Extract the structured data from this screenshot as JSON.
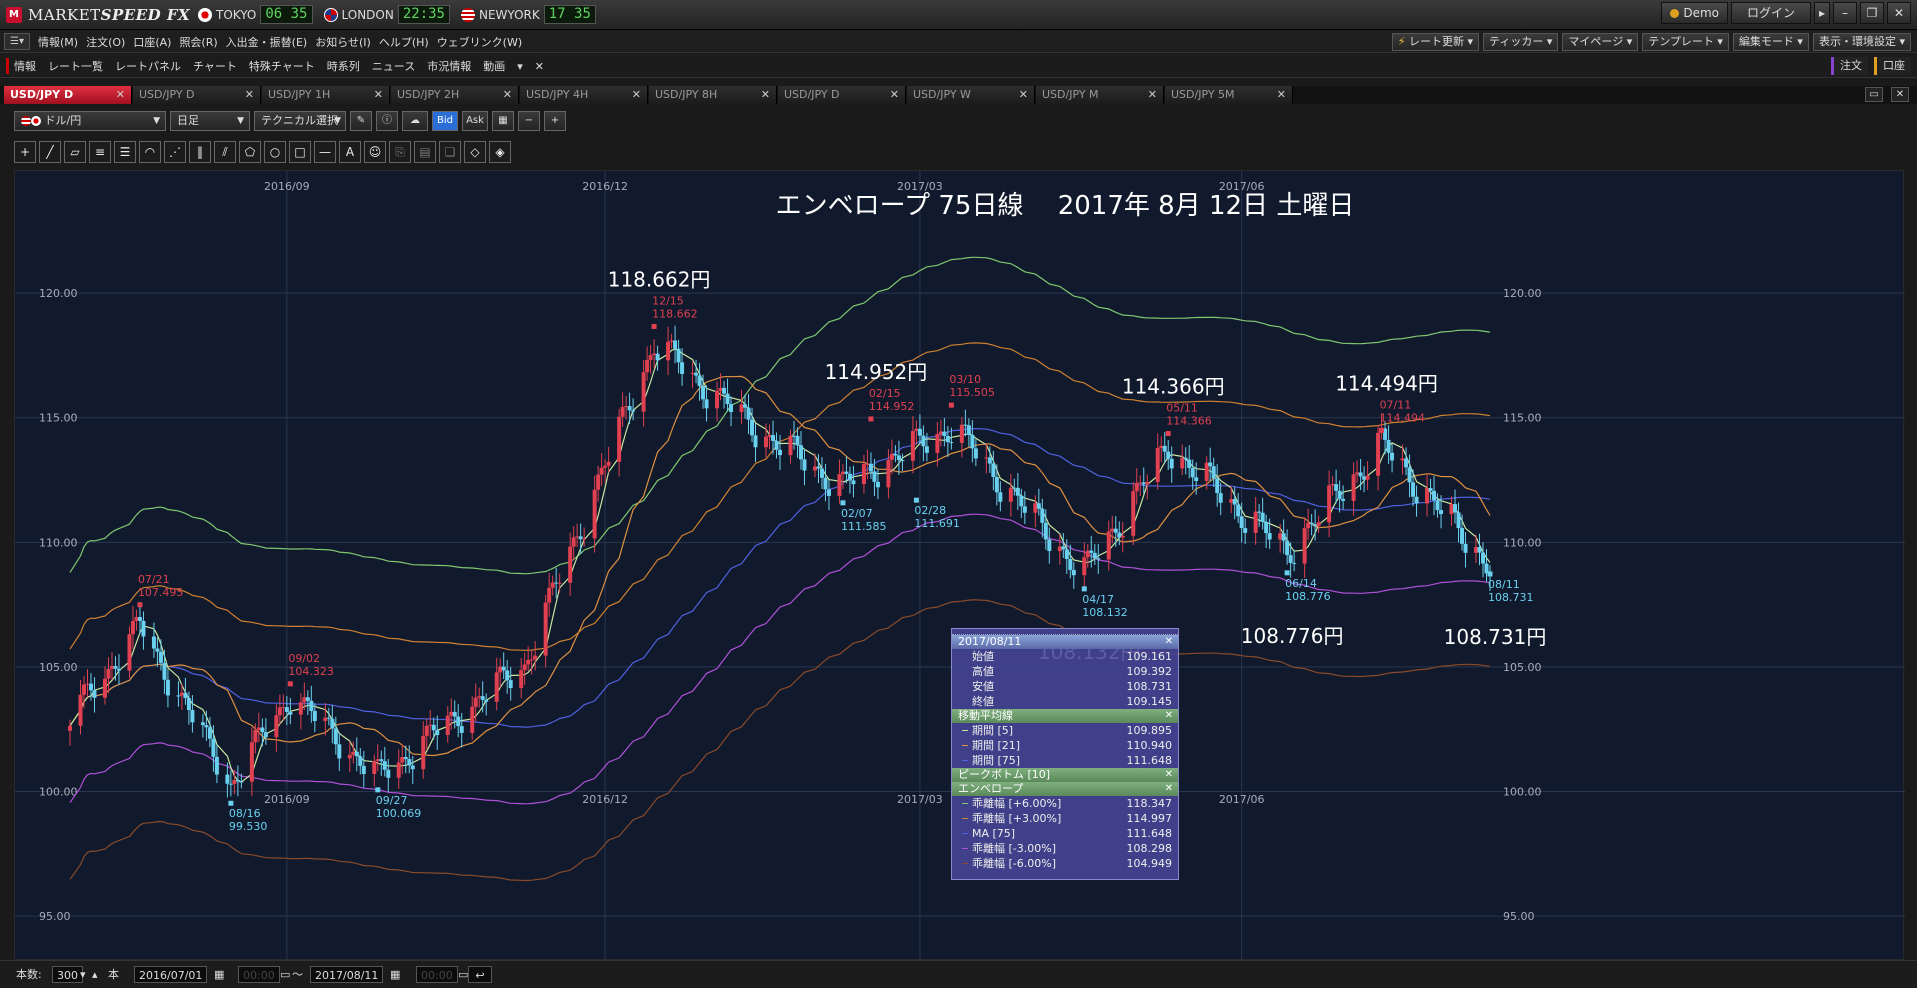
{
  "titlebar": {
    "brand_left": "MARKET",
    "brand_right": "SPEED FX",
    "clocks": [
      {
        "city": "TOKYO",
        "time": "06 35"
      },
      {
        "city": "LONDON",
        "time": "22:35"
      },
      {
        "city": "NEWYORK",
        "time": "17 35"
      }
    ],
    "demo_label": "Demo",
    "login_label": "ログイン"
  },
  "menubar": {
    "items": [
      "情報(M)",
      "注文(O)",
      "口座(A)",
      "照会(R)",
      "入出金・振替(E)",
      "お知らせ(I)",
      "ヘルプ(H)",
      "ウェブリンク(W)"
    ],
    "right_items": [
      "レート更新",
      "ティッカー",
      "マイページ",
      "テンプレート",
      "編集モード",
      "表示・環境設定"
    ]
  },
  "secbar": {
    "items": [
      "情報",
      "レート一覧",
      "レートパネル",
      "チャート",
      "特殊チャート",
      "時系列",
      "ニュース",
      "市況情報",
      "動画"
    ],
    "right_items": [
      "注文",
      "口座"
    ]
  },
  "tabs": [
    "USD/JPY D",
    "USD/JPY D",
    "USD/JPY 1H",
    "USD/JPY 2H",
    "USD/JPY 4H",
    "USD/JPY 8H",
    "USD/JPY D",
    "USD/JPY W",
    "USD/JPY M",
    "USD/JPY 5M"
  ],
  "toolbar": {
    "symbol": "ドル/円",
    "period": "日足",
    "technical": "テクニカル選択",
    "bid": "Bid",
    "ask": "Ask"
  },
  "chart_data": {
    "type": "candlestick",
    "title": "エンベロープ 75日線　 2017年 8月 12日 土曜日",
    "y_ticks": [
      "120.00",
      "115.00",
      "110.00",
      "105.00",
      "100.00",
      "95.00"
    ],
    "ylim": [
      93.2,
      124.9
    ],
    "x_ticks": [
      "2016/09",
      "2016/12",
      "2017/03",
      "2017/06"
    ],
    "peaks": [
      {
        "date": "07/21",
        "value": "107.495",
        "big": ""
      },
      {
        "date": "09/02",
        "value": "104.323",
        "big": ""
      },
      {
        "date": "12/15",
        "value": "118.662",
        "big": "118.662円"
      },
      {
        "date": "02/15",
        "value": "114.952",
        "big": "114.952円"
      },
      {
        "date": "03/10",
        "value": "115.505",
        "big": ""
      },
      {
        "date": "05/11",
        "value": "114.366",
        "big": "114.366円"
      },
      {
        "date": "07/11",
        "value": "114.494",
        "big": "114.494円"
      }
    ],
    "troughs": [
      {
        "date": "08/16",
        "value": "99.530",
        "big": ""
      },
      {
        "date": "09/27",
        "value": "100.069",
        "big": ""
      },
      {
        "date": "02/07",
        "value": "111.585",
        "big": ""
      },
      {
        "date": "02/28",
        "value": "111.691",
        "big": ""
      },
      {
        "date": "04/17",
        "value": "108.132",
        "big": "108.132円"
      },
      {
        "date": "06/14",
        "value": "108.776",
        "big": "108.776円"
      },
      {
        "date": "08/11",
        "value": "108.731",
        "big": "108.731円"
      }
    ],
    "key_closes": [
      {
        "date": "2016/07/01",
        "value": 102.8
      },
      {
        "date": "2016/07/21",
        "value": 106.5
      },
      {
        "date": "2016/08/16",
        "value": 100.2
      },
      {
        "date": "2016/09/02",
        "value": 103.8
      },
      {
        "date": "2016/09/27",
        "value": 100.5
      },
      {
        "date": "2016/11/08",
        "value": 105.0
      },
      {
        "date": "2016/12/15",
        "value": 117.9
      },
      {
        "date": "2017/01/13",
        "value": 114.5
      },
      {
        "date": "2017/02/07",
        "value": 112.2
      },
      {
        "date": "2017/03/10",
        "value": 114.6
      },
      {
        "date": "2017/04/17",
        "value": 108.7
      },
      {
        "date": "2017/05/11",
        "value": 113.8
      },
      {
        "date": "2017/06/14",
        "value": 109.6
      },
      {
        "date": "2017/07/11",
        "value": 113.9
      },
      {
        "date": "2017/08/11",
        "value": 109.1
      }
    ],
    "series": [
      {
        "name": "期間 [5]",
        "color": "#c8e6a0"
      },
      {
        "name": "期間 [21]",
        "color": "#e09040"
      },
      {
        "name": "期間 [75]",
        "color": "#5060e0"
      },
      {
        "name": "乖離幅 [+6.00%]",
        "color": "#80c870"
      },
      {
        "name": "乖離幅 [+3.00%]",
        "color": "#d08030"
      },
      {
        "name": "乖離幅 [-3.00%]",
        "color": "#b050d8"
      },
      {
        "name": "乖離幅 [-6.00%]",
        "color": "#8a4a2a"
      }
    ],
    "colors": {
      "up": "#e04050",
      "down": "#6ad0f0",
      "grid": "#2a3550",
      "bg": "#101a2c"
    }
  },
  "panel": {
    "date": "2017/08/11",
    "ohlc": [
      {
        "label": "始値",
        "value": "109.161"
      },
      {
        "label": "高値",
        "value": "109.392"
      },
      {
        "label": "安値",
        "value": "108.731"
      },
      {
        "label": "終値",
        "value": "109.145"
      }
    ],
    "ma_title": "移動平均線",
    "ma": [
      {
        "label": "期間 [5]",
        "value": "109.895",
        "color": "#c8e6a0"
      },
      {
        "label": "期間 [21]",
        "value": "110.940",
        "color": "#e09040"
      },
      {
        "label": "期間 [75]",
        "value": "111.648",
        "color": "#5060e0"
      }
    ],
    "pb_title": "ピークボトム [10]",
    "env_title": "エンベロープ",
    "env": [
      {
        "label": "乖離幅 [+6.00%]",
        "value": "118.347",
        "color": "#80c870"
      },
      {
        "label": "乖離幅 [+3.00%]",
        "value": "114.997",
        "color": "#d08030"
      },
      {
        "label": "MA [75]",
        "value": "111.648",
        "color": "#5060e0"
      },
      {
        "label": "乖離幅 [-3.00%]",
        "value": "108.298",
        "color": "#b050d8"
      },
      {
        "label": "乖離幅 [-6.00%]",
        "value": "104.949",
        "color": "#8a4a2a"
      }
    ]
  },
  "bottom": {
    "count_label": "本数:",
    "count": "300",
    "unit": "本",
    "from_date": "2016/07/01",
    "from_time": "00:00",
    "tilde": "〜",
    "to_date": "2017/08/11",
    "to_time": "00:00"
  }
}
